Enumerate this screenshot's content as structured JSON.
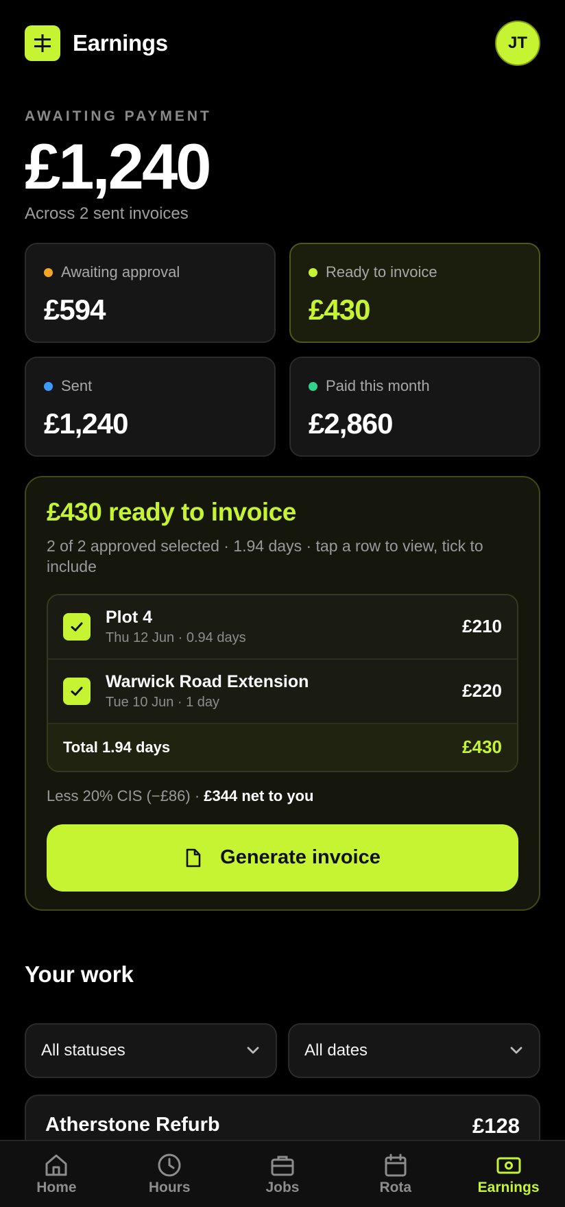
{
  "header": {
    "title": "Earnings",
    "avatar_initials": "JT",
    "logo_icon": "split-sign-icon"
  },
  "summary": {
    "label": "AWAITING PAYMENT",
    "amount": "£1,240",
    "subtitle": "Across 2 sent invoices"
  },
  "stats": [
    {
      "label": "Awaiting approval",
      "value": "£594",
      "dot_color": "#f5a623"
    },
    {
      "label": "Ready to invoice",
      "value": "£430",
      "dot_color": "#c6f432"
    },
    {
      "label": "Sent",
      "value": "£1,240",
      "dot_color": "#3d9bff"
    },
    {
      "label": "Paid this month",
      "value": "£2,860",
      "dot_color": "#2fd38a"
    }
  ],
  "invoice": {
    "title": "£430 ready to invoice",
    "subtitle": "2 of 2 approved selected · 1.94 days · tap a row to view, tick to include",
    "items": [
      {
        "name": "Plot 4",
        "meta": "Thu 12 Jun · 0.94 days",
        "amount": "£210",
        "checked": true
      },
      {
        "name": "Warwick Road Extension",
        "meta": "Tue 10 Jun · 1 day",
        "amount": "£220",
        "checked": true
      }
    ],
    "total_label": "Total 1.94 days",
    "total_amount": "£430",
    "cis_text": "Less 20% CIS (−£86) · ",
    "cis_net": "£344 net to you",
    "button_label": "Generate invoice"
  },
  "work": {
    "title": "Your work",
    "status_filter": "All statuses",
    "date_filter": "All dates",
    "first_item": {
      "name": "Atherstone Refurb",
      "amount": "£128"
    }
  },
  "tabs": [
    {
      "label": "Home",
      "icon": "home-icon",
      "active": false
    },
    {
      "label": "Hours",
      "icon": "clock-icon",
      "active": false
    },
    {
      "label": "Jobs",
      "icon": "briefcase-icon",
      "active": false
    },
    {
      "label": "Rota",
      "icon": "calendar-icon",
      "active": false
    },
    {
      "label": "Earnings",
      "icon": "banknote-icon",
      "active": true
    }
  ],
  "colors": {
    "accent": "#c6f432",
    "background": "#000000",
    "card": "#161616"
  }
}
